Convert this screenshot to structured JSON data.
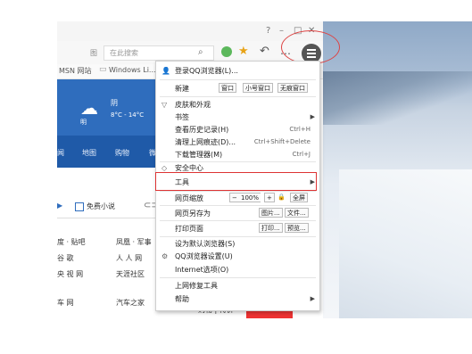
{
  "window": {
    "minimize": "–",
    "maximize": "□",
    "close": "✕",
    "help": "?"
  },
  "toolbar": {
    "search_placeholder": "在此搜索",
    "favorites_char": "图"
  },
  "bookmarks": {
    "left": "MSN 网站",
    "right": "Windows Li..."
  },
  "weather": {
    "condition": "阴",
    "temp": "8°C - 14°C",
    "tag": "明"
  },
  "nav": {
    "tabs": [
      "闻",
      "地图",
      "购物",
      "微"
    ]
  },
  "page": {
    "free_novel": "免费小说",
    "links": [
      [
        "度 · 贴吧",
        "凤凰 · 军事"
      ],
      [
        "谷 歌",
        "人 人 网"
      ],
      [
        "央 视 网",
        "天涯社区"
      ],
      [
        "车 网",
        "汽车之家"
      ]
    ],
    "banner": "购物 | 特价"
  },
  "menu": {
    "login": "登录QQ浏览器(L)...",
    "new": "新建",
    "new_window": "窗口",
    "new_small_window": "小号窗口",
    "new_private": "无痕窗口",
    "skin": "皮肤和外观",
    "bookmarks": "书签",
    "history": "查看历史记录(H)",
    "history_key": "Ctrl+H",
    "clear": "清理上网痕迹(D)...",
    "clear_key": "Ctrl+Shift+Delete",
    "downloads": "下载管理器(M)",
    "downloads_key": "Ctrl+J",
    "security": "安全中心",
    "tools": "工具",
    "zoom": "网页缩放",
    "zoom_minus": "−",
    "zoom_value": "100%",
    "zoom_plus": "+",
    "fullscreen": "全屏",
    "save_as": "网页另存为",
    "save_image": "图片...",
    "save_file": "文件...",
    "print": "打印页面",
    "print_btn": "打印...",
    "preview_btn": "预览...",
    "default_browser": "设为默认浏览器(S)",
    "settings": "QQ浏览器设置(U)",
    "internet_options": "Internet选项(O)",
    "repair": "上网修复工具",
    "help": "帮助"
  }
}
